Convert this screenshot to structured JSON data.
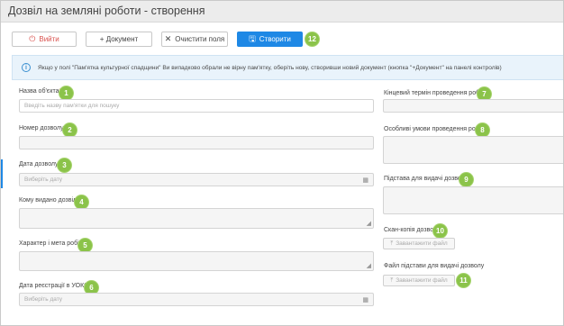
{
  "window": {
    "title": "Дозвіл на земляні роботи - створення"
  },
  "toolbar": {
    "exit_label": "Вийти",
    "document_label": "+ Документ",
    "clear_label": "Очистити поля",
    "create_label": "Створити"
  },
  "info": {
    "text": "Якщо у полі \"Пам'ятка культурної спадщини\" Ви випадково обрали не вірну пам'ятку, оберіть нову, створивши новий документ (кнопка \"+Документ\" на панелі контролів)"
  },
  "fields": {
    "object_name": {
      "label": "Назва об'єкта",
      "placeholder": "Введіть назву пам'ятки для пошуку",
      "badge": "1"
    },
    "permit_number": {
      "label": "Номер дозволу",
      "badge": "2"
    },
    "permit_date": {
      "label": "Дата дозволу",
      "placeholder": "Виберіть дату",
      "badge": "3"
    },
    "issued_to": {
      "label": "Кому видано дозвіл",
      "badge": "4"
    },
    "work_purpose": {
      "label": "Характер і мета робіт",
      "badge": "5"
    },
    "ukos_date": {
      "label": "Дата реєстрації в УОКС",
      "placeholder": "Виберіть дату",
      "badge": "6"
    },
    "end_date": {
      "label": "Кінцевий термін проведення робіт",
      "badge": "7"
    },
    "special_conditions": {
      "label": "Особливі умови проведення робіт",
      "badge": "8"
    },
    "issue_basis": {
      "label": "Підстава для видачі дозволу",
      "badge": "9"
    },
    "scan_copy": {
      "label": "Скан-копія дозволу",
      "upload_label": "Завантажити файл",
      "badge": "10"
    },
    "basis_file": {
      "label": "Файл підстави для видачі дозволу",
      "upload_label": "Завантажити файл",
      "badge": "11"
    }
  },
  "create_badge": "12",
  "colors": {
    "accent": "#1e88e5",
    "badge": "#8bc34a",
    "required": "#d9534f",
    "info_bg": "#e9f3fb"
  }
}
